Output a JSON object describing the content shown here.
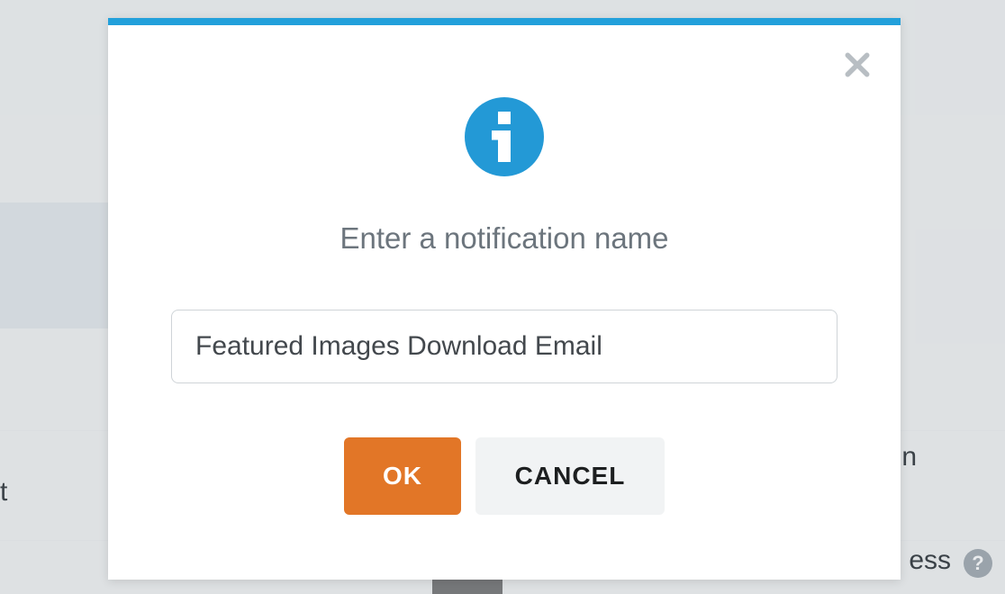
{
  "modal": {
    "prompt": "Enter a notification name",
    "input_value": "Featured Images Download Email",
    "ok_label": "OK",
    "cancel_label": "CANCEL"
  },
  "background": {
    "left_row_fragment": "t",
    "right_row_fragment": "n",
    "bottom_fragment": "ess",
    "help_glyph": "?"
  },
  "colors": {
    "accent_blue": "#22a0db",
    "info_blue": "#2399d6",
    "ok_orange": "#e27627",
    "cancel_gray": "#f1f3f4",
    "text_muted": "#6c757d"
  }
}
